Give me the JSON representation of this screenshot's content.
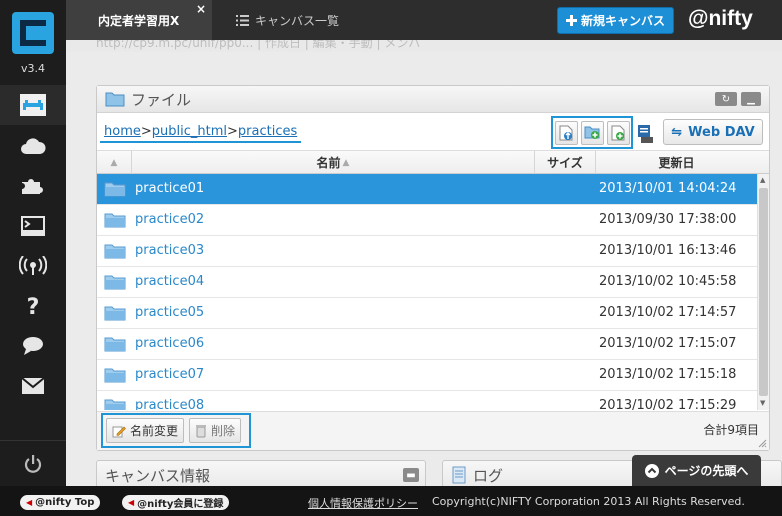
{
  "app": {
    "version": "v3.4",
    "brand": "@nifty",
    "tabs": [
      {
        "label": "内定者学習用X",
        "active": true,
        "close": "×"
      },
      {
        "label": "キャンバス一覧",
        "active": false
      }
    ],
    "new_canvas_label": "新規キャンバス"
  },
  "ghost_text": "http://cp9.m.pc/unif/pp0...  | 作成日  |  編集・手動  |  メンバ",
  "file_panel": {
    "title": "ファイル",
    "breadcrumb": [
      "home",
      "public_html",
      "practices"
    ],
    "webdav_label": "Web DAV",
    "columns": {
      "name": "名前",
      "size": "サイズ",
      "date": "更新日"
    },
    "rows": [
      {
        "name": "practice01",
        "date": "2013/10/01 14:04:24",
        "selected": true
      },
      {
        "name": "practice02",
        "date": "2013/09/30 17:38:00",
        "selected": false
      },
      {
        "name": "practice03",
        "date": "2013/10/01 16:13:46",
        "selected": false
      },
      {
        "name": "practice04",
        "date": "2013/10/02 10:45:58",
        "selected": false
      },
      {
        "name": "practice05",
        "date": "2013/10/02 17:14:57",
        "selected": false
      },
      {
        "name": "practice06",
        "date": "2013/10/02 17:15:07",
        "selected": false
      },
      {
        "name": "practice07",
        "date": "2013/10/02 17:15:18",
        "selected": false
      },
      {
        "name": "practice08",
        "date": "2013/10/02 17:15:29",
        "selected": false
      }
    ],
    "rename_label": "名前変更",
    "delete_label": "削除",
    "total": "合計9項目"
  },
  "lower": {
    "canvas_info_title": "キャンバス情報",
    "log_title": "ログ",
    "page_top_label": "ページの先頭へ"
  },
  "footer": {
    "nifty_top": "@nifty Top",
    "register": "@nifty会員に登録",
    "privacy": "個人情報保護ポリシー",
    "copyright": "Copyright(c)NIFTY Corporation 2013 All Rights Reserved."
  },
  "colors": {
    "accent": "#1f95d6",
    "selected_row": "#2b95dc",
    "sidebar": "#1d1d1d",
    "new_button": "#1c8fd6"
  }
}
